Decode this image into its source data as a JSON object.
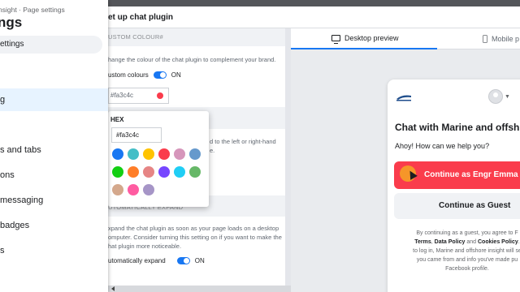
{
  "sidebar": {
    "breadcrumb": "nsight · Page settings",
    "title": "ngs",
    "search": "ettings",
    "items": [
      {
        "label": "g",
        "active": true
      },
      {
        "label": "s and tabs",
        "active": false
      },
      {
        "label": "ons",
        "active": false
      },
      {
        "label": " messaging",
        "active": false
      },
      {
        "label": " badges",
        "active": false
      },
      {
        "label": "s",
        "active": false
      }
    ]
  },
  "header": {
    "title": "et up chat plugin"
  },
  "settings": {
    "custom_colour": {
      "heading": "USTOM COLOUR#",
      "description": "hange the colour of the chat plugin to complement your brand.",
      "toggle_label": "ustom colours",
      "toggle_state": "ON",
      "value": "#fa3c4c"
    },
    "alignment": {
      "description_line1": "d to the left or right-hand",
      "description_line2": "e."
    },
    "auto_expand": {
      "heading": "UTOMATICALLY EXPAND",
      "description_line1": "xpand the chat plugin as soon as your page loads on a desktop",
      "description_line2": "omputer. Consider turning this setting on if you want to make the",
      "description_line3": "hat plugin more noticeable.",
      "toggle_label": "utomatically expand",
      "toggle_state": "ON"
    }
  },
  "color_picker": {
    "label": "HEX",
    "value": "#fa3c4c",
    "swatches": [
      "#1877f2",
      "#44bec7",
      "#ffc300",
      "#fa3c4c",
      "#d696bb",
      "#6699cc",
      "#13cf13",
      "#ff7e29",
      "#e68585",
      "#7646ff",
      "#20cef5",
      "#67b868",
      "#d4a88c",
      "#ff5ca1",
      "#a695c7"
    ]
  },
  "preview": {
    "tabs": [
      {
        "label": "Desktop preview",
        "active": true,
        "icon": "monitor-icon"
      },
      {
        "label": "Mobile p",
        "active": false,
        "icon": "phone-icon"
      }
    ],
    "widget": {
      "title": "Chat with Marine and offsh",
      "greeting": "Ahoy! How can we help you?",
      "primary_button": "Continue as Engr Emma",
      "guest_button": "Continue as Guest",
      "legal_1": "By continuing as a guest, you agree to F",
      "legal_terms": "Terms",
      "legal_data": "Data Policy",
      "legal_and": "and",
      "legal_cookies": "Cookies Policy",
      "legal_2": "to log in, Marine and offshore insight will se",
      "legal_3": "you came from and info you've made pu",
      "legal_4": "Facebook profile.",
      "accent": "#fa3c4c"
    }
  },
  "colors": {
    "accent": "#fa3c4c",
    "facebook_blue": "#1877f2"
  }
}
